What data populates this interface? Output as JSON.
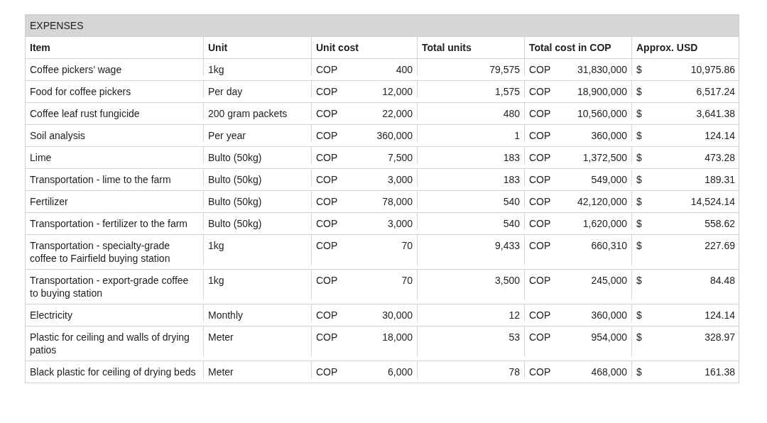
{
  "table": {
    "title": "EXPENSES",
    "columns": [
      "Item",
      "Unit",
      "Unit cost",
      "Total units",
      "Total cost in COP",
      "Approx. USD"
    ],
    "rows": [
      {
        "item": "Coffee pickers’ wage",
        "unit": "1kg",
        "cost_currency": "COP",
        "unit_cost": "400",
        "total_units": "79,575",
        "total_currency": "COP",
        "total_cost": "31,830,000",
        "usd_currency": "$",
        "usd": "10,975.86"
      },
      {
        "item": "Food for coffee pickers",
        "unit": "Per day",
        "cost_currency": "COP",
        "unit_cost": "12,000",
        "total_units": "1,575",
        "total_currency": "COP",
        "total_cost": "18,900,000",
        "usd_currency": "$",
        "usd": "6,517.24"
      },
      {
        "item": "Coffee leaf rust fungicide",
        "unit": "200 gram packets",
        "cost_currency": "COP",
        "unit_cost": "22,000",
        "total_units": "480",
        "total_currency": "COP",
        "total_cost": "10,560,000",
        "usd_currency": "$",
        "usd": "3,641.38"
      },
      {
        "item": "Soil analysis",
        "unit": "Per year",
        "cost_currency": "COP",
        "unit_cost": "360,000",
        "total_units": "1",
        "total_currency": "COP",
        "total_cost": "360,000",
        "usd_currency": "$",
        "usd": "124.14"
      },
      {
        "item": "Lime",
        "unit": "Bulto (50kg)",
        "cost_currency": "COP",
        "unit_cost": "7,500",
        "total_units": "183",
        "total_currency": "COP",
        "total_cost": "1,372,500",
        "usd_currency": "$",
        "usd": "473.28"
      },
      {
        "item": "Transportation - lime to the farm",
        "unit": "Bulto (50kg)",
        "cost_currency": "COP",
        "unit_cost": "3,000",
        "total_units": "183",
        "total_currency": "COP",
        "total_cost": "549,000",
        "usd_currency": "$",
        "usd": "189.31"
      },
      {
        "item": "Fertilizer",
        "unit": "Bulto (50kg)",
        "cost_currency": "COP",
        "unit_cost": "78,000",
        "total_units": "540",
        "total_currency": "COP",
        "total_cost": "42,120,000",
        "usd_currency": "$",
        "usd": "14,524.14"
      },
      {
        "item": "Transportation - fertilizer to the farm",
        "unit": "Bulto (50kg)",
        "cost_currency": "COP",
        "unit_cost": "3,000",
        "total_units": "540",
        "total_currency": "COP",
        "total_cost": "1,620,000",
        "usd_currency": "$",
        "usd": "558.62"
      },
      {
        "item": "Transportation - specialty-grade coffee to Fairfield buying station",
        "unit": "1kg",
        "cost_currency": "COP",
        "unit_cost": "70",
        "total_units": "9,433",
        "total_currency": "COP",
        "total_cost": "660,310",
        "usd_currency": "$",
        "usd": "227.69"
      },
      {
        "item": "Transportation - export-grade coffee to buying station",
        "unit": "1kg",
        "cost_currency": "COP",
        "unit_cost": "70",
        "total_units": "3,500",
        "total_currency": "COP",
        "total_cost": "245,000",
        "usd_currency": "$",
        "usd": "84.48"
      },
      {
        "item": "Electricity",
        "unit": "Monthly",
        "cost_currency": "COP",
        "unit_cost": "30,000",
        "total_units": "12",
        "total_currency": "COP",
        "total_cost": "360,000",
        "usd_currency": "$",
        "usd": "124.14"
      },
      {
        "item": "Plastic for ceiling and walls of drying patios",
        "unit": "Meter",
        "cost_currency": "COP",
        "unit_cost": "18,000",
        "total_units": "53",
        "total_currency": "COP",
        "total_cost": "954,000",
        "usd_currency": "$",
        "usd": "328.97"
      },
      {
        "item": "Black plastic for ceiling of drying beds",
        "unit": "Meter",
        "cost_currency": "COP",
        "unit_cost": "6,000",
        "total_units": "78",
        "total_currency": "COP",
        "total_cost": "468,000",
        "usd_currency": "$",
        "usd": "161.38"
      }
    ]
  }
}
